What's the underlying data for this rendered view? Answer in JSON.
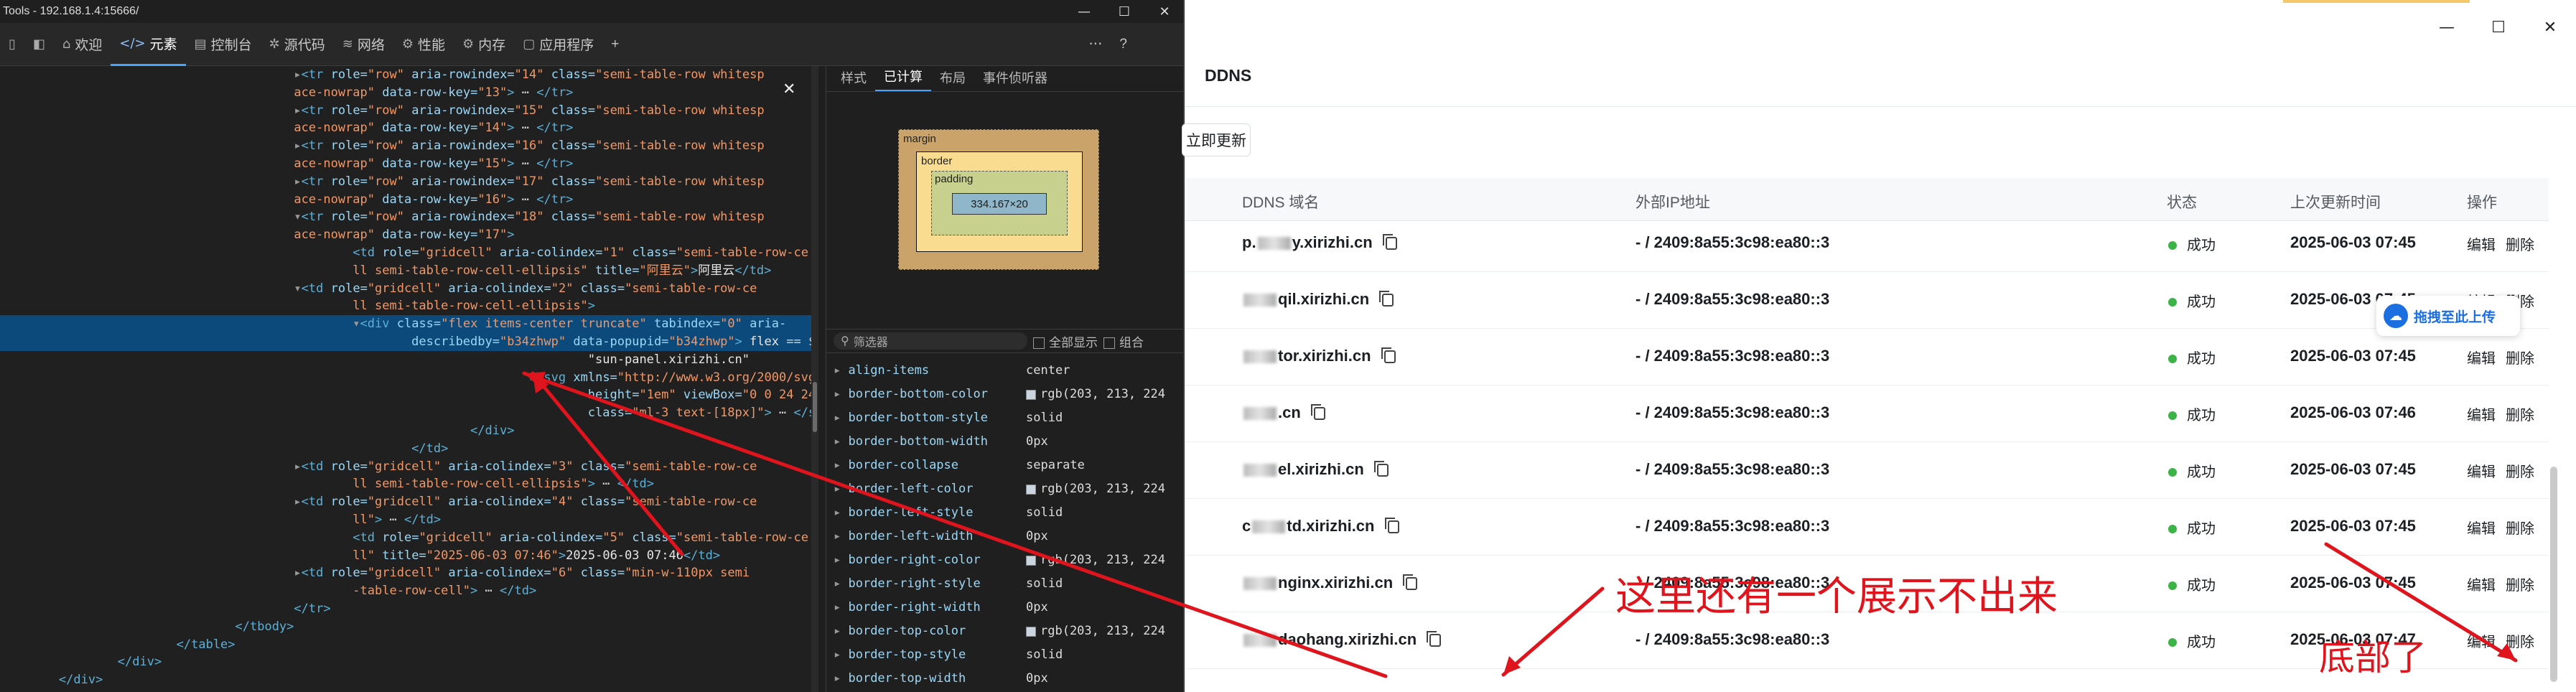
{
  "devtools": {
    "title": "Tools - 192.168.1.4:15666/",
    "window_buttons": [
      "—",
      "☐",
      "✕"
    ],
    "tabs": [
      {
        "label": "欢迎",
        "icon": "home-icon",
        "glyph": "⌂"
      },
      {
        "label": "元素",
        "icon": "code-icon",
        "glyph": "</>"
      },
      {
        "label": "控制台",
        "icon": "console-icon",
        "glyph": "▤"
      },
      {
        "label": "源代码",
        "icon": "bug-icon",
        "glyph": "✲"
      },
      {
        "label": "网络",
        "icon": "wifi-icon",
        "glyph": "≋"
      },
      {
        "label": "性能",
        "icon": "performance-icon",
        "glyph": "⚙"
      },
      {
        "label": "内存",
        "icon": "memory-icon",
        "glyph": "⚙"
      },
      {
        "label": "应用程序",
        "icon": "app-icon",
        "glyph": "▢"
      }
    ],
    "add_tab": "+",
    "more": "⋯",
    "help": "?",
    "elements_lines": [
      {
        "indent": "     ",
        "html": "<span class='chev'>▸</span><span class='tag'>&lt;tr</span> <span class='attr'>role=</span><span class='val'>\"row\"</span> <span class='attr'>aria-rowindex=</span><span class='val'>\"14\"</span> <span class='attr'>class=</span><span class='val'>\"semi-table-row whitesp</span>"
      },
      {
        "indent": "     ",
        "html": "<span class='val'>ace-nowrap\"</span> <span class='attr'>data-row-key=</span><span class='val'>\"13\"</span><span class='tag'>&gt;</span> ⋯ <span class='tag'>&lt;/tr&gt;</span>"
      },
      {
        "indent": "     ",
        "html": "<span class='chev'>▸</span><span class='tag'>&lt;tr</span> <span class='attr'>role=</span><span class='val'>\"row\"</span> <span class='attr'>aria-rowindex=</span><span class='val'>\"15\"</span> <span class='attr'>class=</span><span class='val'>\"semi-table-row whitesp</span>"
      },
      {
        "indent": "     ",
        "html": "<span class='val'>ace-nowrap\"</span> <span class='attr'>data-row-key=</span><span class='val'>\"14\"</span><span class='tag'>&gt;</span> ⋯ <span class='tag'>&lt;/tr&gt;</span>"
      },
      {
        "indent": "     ",
        "html": "<span class='chev'>▸</span><span class='tag'>&lt;tr</span> <span class='attr'>role=</span><span class='val'>\"row\"</span> <span class='attr'>aria-rowindex=</span><span class='val'>\"16\"</span> <span class='attr'>class=</span><span class='val'>\"semi-table-row whitesp</span>"
      },
      {
        "indent": "     ",
        "html": "<span class='val'>ace-nowrap\"</span> <span class='attr'>data-row-key=</span><span class='val'>\"15\"</span><span class='tag'>&gt;</span> ⋯ <span class='tag'>&lt;/tr&gt;</span>"
      },
      {
        "indent": "     ",
        "html": "<span class='chev'>▸</span><span class='tag'>&lt;tr</span> <span class='attr'>role=</span><span class='val'>\"row\"</span> <span class='attr'>aria-rowindex=</span><span class='val'>\"17\"</span> <span class='attr'>class=</span><span class='val'>\"semi-table-row whitesp</span>"
      },
      {
        "indent": "     ",
        "html": "<span class='val'>ace-nowrap\"</span> <span class='attr'>data-row-key=</span><span class='val'>\"16\"</span><span class='tag'>&gt;</span> ⋯ <span class='tag'>&lt;/tr&gt;</span>"
      },
      {
        "indent": "     ",
        "html": "<span class='chev'>▾</span><span class='tag'>&lt;tr</span> <span class='attr'>role=</span><span class='val'>\"row\"</span> <span class='attr'>aria-rowindex=</span><span class='val'>\"18\"</span> <span class='attr'>class=</span><span class='val'>\"semi-table-row whitesp</span>"
      },
      {
        "indent": "     ",
        "html": "<span class='val'>ace-nowrap\"</span> <span class='attr'>data-row-key=</span><span class='val'>\"17\"</span><span class='tag'>&gt;</span>"
      },
      {
        "indent": "      ",
        "html": "<span class='tag'>&lt;td</span> <span class='attr'>role=</span><span class='val'>\"gridcell\"</span> <span class='attr'>aria-colindex=</span><span class='val'>\"1\"</span> <span class='attr'>class=</span><span class='val'>\"semi-table-row-ce</span>"
      },
      {
        "indent": "      ",
        "html": "<span class='val'>ll semi-table-row-cell-ellipsis\"</span> <span class='attr'>title=</span><span class='val'>\"阿里云\"</span><span class='tag'>&gt;</span><span class='txt'>阿里云</span><span class='tag'>&lt;/td&gt;</span>"
      },
      {
        "indent": "     ",
        "html": "<span class='chev'>▾</span><span class='tag'>&lt;td</span> <span class='attr'>role=</span><span class='val'>\"gridcell\"</span> <span class='attr'>aria-colindex=</span><span class='val'>\"2\"</span> <span class='attr'>class=</span><span class='val'>\"semi-table-row-ce</span>"
      },
      {
        "indent": "      ",
        "html": "<span class='val'>ll semi-table-row-cell-ellipsis\"</span><span class='tag'>&gt;</span>"
      },
      {
        "indent": "      ",
        "sel": true,
        "html": "<span class='chev'>▾</span><span class='tag'>&lt;div</span> <span class='attr'>class=</span><span class='val'>\"flex items-center truncate\"</span> <span class='attr'>tabindex=</span><span class='val'>\"0\"</span> <span class='attr'>aria-</span>"
      },
      {
        "indent": "       ",
        "sel": true,
        "html": "<span class='attr'>describedby=</span><span class='val'>\"b34zhwp\"</span> <span class='attr'>data-popupid=</span><span class='val'>\"b34zhwp\"</span><span class='tag'>&gt;</span> <span class='txt'>flex</span> == $0"
      },
      {
        "indent": "          ",
        "html": "<span class='txt'>\"sun-panel.xirizhi.cn\"</span>"
      },
      {
        "indent": "         ",
        "html": "<span class='chev'>▸</span><span class='tag'>&lt;svg</span> <span class='attr'>xmlns=</span><span class='val'>\"http://www.w3.org/2000/svg\"</span> <span class='attr'>width=</span><span class='val'>\"1em\"</span>"
      },
      {
        "indent": "          ",
        "html": "<span class='attr'>height=</span><span class='val'>\"1em\"</span> <span class='attr'>viewBox=</span><span class='val'>\"0 0 24 24\"</span> <span class='attr'>fill=</span><span class='val'>\"currentColor\"</span>"
      },
      {
        "indent": "          ",
        "html": "<span class='attr'>class=</span><span class='val'>\"ml-3 text-[18px]\"</span><span class='tag'>&gt;</span> ⋯ <span class='tag'>&lt;/svg&gt;</span>"
      },
      {
        "indent": "        ",
        "html": "<span class='tag'>&lt;/div&gt;</span>"
      },
      {
        "indent": "       ",
        "html": "<span class='tag'>&lt;/td&gt;</span>"
      },
      {
        "indent": "     ",
        "html": "<span class='chev'>▸</span><span class='tag'>&lt;td</span> <span class='attr'>role=</span><span class='val'>\"gridcell\"</span> <span class='attr'>aria-colindex=</span><span class='val'>\"3\"</span> <span class='attr'>class=</span><span class='val'>\"semi-table-row-ce</span>"
      },
      {
        "indent": "      ",
        "html": "<span class='val'>ll semi-table-row-cell-ellipsis\"</span><span class='tag'>&gt;</span> ⋯ <span class='tag'>&lt;/td&gt;</span>"
      },
      {
        "indent": "     ",
        "html": "<span class='chev'>▸</span><span class='tag'>&lt;td</span> <span class='attr'>role=</span><span class='val'>\"gridcell\"</span> <span class='attr'>aria-colindex=</span><span class='val'>\"4\"</span> <span class='attr'>class=</span><span class='val'>\"semi-table-row-ce</span>"
      },
      {
        "indent": "      ",
        "html": "<span class='val'>ll\"</span><span class='tag'>&gt;</span> ⋯ <span class='tag'>&lt;/td&gt;</span>"
      },
      {
        "indent": "      ",
        "html": "<span class='tag'>&lt;td</span> <span class='attr'>role=</span><span class='val'>\"gridcell\"</span> <span class='attr'>aria-colindex=</span><span class='val'>\"5\"</span> <span class='attr'>class=</span><span class='val'>\"semi-table-row-ce</span>"
      },
      {
        "indent": "      ",
        "html": "<span class='val'>ll\"</span> <span class='attr'>title=</span><span class='val'>\"2025-06-03 07:46\"</span><span class='tag'>&gt;</span><span class='txt'>2025-06-03 07:46</span><span class='tag'>&lt;/td&gt;</span>"
      },
      {
        "indent": "     ",
        "html": "<span class='chev'>▸</span><span class='tag'>&lt;td</span> <span class='attr'>role=</span><span class='val'>\"gridcell\"</span> <span class='attr'>aria-colindex=</span><span class='val'>\"6\"</span> <span class='attr'>class=</span><span class='val'>\"min-w-110px semi</span>"
      },
      {
        "indent": "      ",
        "html": "<span class='val'>-table-row-cell\"</span><span class='tag'>&gt;</span> ⋯ <span class='tag'>&lt;/td&gt;</span>"
      },
      {
        "indent": "     ",
        "html": "<span class='tag'>&lt;/tr&gt;</span>"
      },
      {
        "indent": "    ",
        "html": "<span class='tag'>&lt;/tbody&gt;</span>"
      },
      {
        "indent": "   ",
        "html": "<span class='tag'>&lt;/table&gt;</span>"
      },
      {
        "indent": "  ",
        "html": "<span class='tag'>&lt;/div&gt;</span>"
      },
      {
        "indent": " ",
        "html": "<span class='tag'>&lt;/div&gt;</span>"
      }
    ],
    "styles_tabs": [
      "样式",
      "已计算",
      "布局",
      "事件侦听器"
    ],
    "box_model": {
      "margin": "margin",
      "border": "border",
      "padding": "padding",
      "content": "334.167×20",
      "dash": "–"
    },
    "filter_placeholder": "筛选器",
    "show_all": "全部显示",
    "group": "组合",
    "computed_props": [
      {
        "name": "align-items",
        "value": "center",
        "swatch": false
      },
      {
        "name": "border-bottom-color",
        "value": "rgb(203, 213, 224",
        "swatch": true
      },
      {
        "name": "border-bottom-style",
        "value": "solid",
        "swatch": false
      },
      {
        "name": "border-bottom-width",
        "value": "0px",
        "swatch": false
      },
      {
        "name": "border-collapse",
        "value": "separate",
        "swatch": false
      },
      {
        "name": "border-left-color",
        "value": "rgb(203, 213, 224",
        "swatch": true
      },
      {
        "name": "border-left-style",
        "value": "solid",
        "swatch": false
      },
      {
        "name": "border-left-width",
        "value": "0px",
        "swatch": false
      },
      {
        "name": "border-right-color",
        "value": "rgb(203, 213, 224",
        "swatch": true
      },
      {
        "name": "border-right-style",
        "value": "solid",
        "swatch": false
      },
      {
        "name": "border-right-width",
        "value": "0px",
        "swatch": false
      },
      {
        "name": "border-top-color",
        "value": "rgb(203, 213, 224",
        "swatch": true
      },
      {
        "name": "border-top-style",
        "value": "solid",
        "swatch": false
      },
      {
        "name": "border-top-width",
        "value": "0px",
        "swatch": false
      }
    ]
  },
  "app": {
    "title": "DDNS",
    "update_button": "立即更新",
    "window_buttons": [
      "—",
      "☐",
      "✕"
    ],
    "columns": [
      "DDNS 域名",
      "外部IP地址",
      "状态",
      "上次更新时间",
      "操作"
    ],
    "rows": [
      {
        "domain_prefix": "p.",
        "domain_suffix": "y.xirizhi.cn",
        "ip": "- / 2409:8a55:3c98:ea80::3",
        "status": "成功",
        "time": "2025-06-03 07:45",
        "edit": "编辑",
        "delete": "删除"
      },
      {
        "domain_prefix": "",
        "domain_suffix": "qil.xirizhi.cn",
        "ip": "- / 2409:8a55:3c98:ea80::3",
        "status": "成功",
        "time": "2025-06-03 07:45",
        "edit": "编辑",
        "delete": "删除"
      },
      {
        "domain_prefix": "",
        "domain_suffix": "tor.xirizhi.cn",
        "ip": "- / 2409:8a55:3c98:ea80::3",
        "status": "成功",
        "time": "2025-06-03 07:45",
        "edit": "编辑",
        "delete": "删除"
      },
      {
        "domain_prefix": "",
        "domain_suffix": ".cn",
        "ip": "- / 2409:8a55:3c98:ea80::3",
        "status": "成功",
        "time": "2025-06-03 07:46",
        "edit": "编辑",
        "delete": "删除"
      },
      {
        "domain_prefix": "",
        "domain_suffix": "el.xirizhi.cn",
        "ip": "- / 2409:8a55:3c98:ea80::3",
        "status": "成功",
        "time": "2025-06-03 07:45",
        "edit": "编辑",
        "delete": "删除"
      },
      {
        "domain_prefix": "c",
        "domain_suffix": "td.xirizhi.cn",
        "ip": "- / 2409:8a55:3c98:ea80::3",
        "status": "成功",
        "time": "2025-06-03 07:45",
        "edit": "编辑",
        "delete": "删除"
      },
      {
        "domain_prefix": "",
        "domain_suffix": "nginx.xirizhi.cn",
        "ip": "- / 2409:8a55:3c98:ea80::3",
        "status": "成功",
        "time": "2025-06-03 07:45",
        "edit": "编辑",
        "delete": "删除"
      },
      {
        "domain_prefix": "",
        "domain_suffix": "daohang.xirizhi.cn",
        "ip": "- / 2409:8a55:3c98:ea80::3",
        "status": "成功",
        "time": "2025-06-03 07:47",
        "edit": "编辑",
        "delete": "删除"
      }
    ],
    "upload_float": "拖拽至此上传"
  },
  "annotations": {
    "note_missing": "这里还有一个展示不出来",
    "note_bottom": "底部了",
    "color": "#e0141c"
  },
  "colors": {
    "devtools_bg": "#1f1f1f",
    "selection": "#0b4a7a",
    "status_green": "#3bb346",
    "accent_blue": "#1b6fe0"
  }
}
